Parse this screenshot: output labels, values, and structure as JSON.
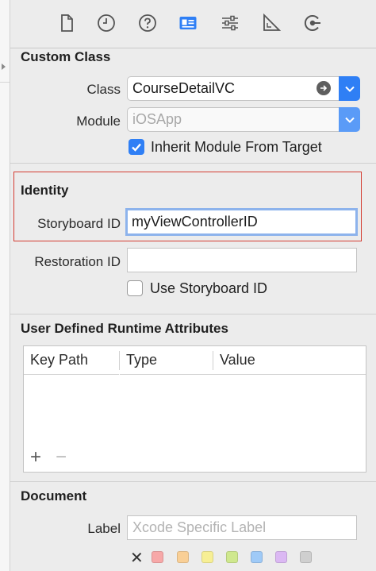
{
  "toolbar": {
    "icons": [
      "file-inspector-icon",
      "history-inspector-icon",
      "quick-help-icon",
      "identity-inspector-icon",
      "attributes-inspector-icon",
      "size-inspector-icon",
      "connections-inspector-icon"
    ],
    "selected": "identity-inspector-icon",
    "accent": "#2f7ff5"
  },
  "custom_class": {
    "title": "Custom Class",
    "class_label": "Class",
    "class_value": "CourseDetailVC",
    "module_label": "Module",
    "module_placeholder": "iOSApp",
    "inherit_label": "Inherit Module From Target",
    "inherit_checked": true
  },
  "identity": {
    "title": "Identity",
    "storyboard_id_label": "Storyboard ID",
    "storyboard_id_value": "myViewControllerID",
    "restoration_id_label": "Restoration ID",
    "restoration_id_value": "",
    "use_storyboard_label": "Use Storyboard ID",
    "use_storyboard_checked": false,
    "highlight_color": "#d43d32"
  },
  "runtime_attributes": {
    "title": "User Defined Runtime Attributes",
    "columns": [
      "Key Path",
      "Type",
      "Value"
    ],
    "rows": [],
    "add_label": "+",
    "remove_label": "−"
  },
  "document": {
    "title": "Document",
    "label_label": "Label",
    "label_placeholder": "Xcode Specific Label",
    "clear_label": "✕",
    "swatches": [
      "#f7a8a8",
      "#f9cf96",
      "#f7ef95",
      "#cfe88e",
      "#9fcaf7",
      "#dbb8f3",
      "#cfcfcf"
    ]
  }
}
